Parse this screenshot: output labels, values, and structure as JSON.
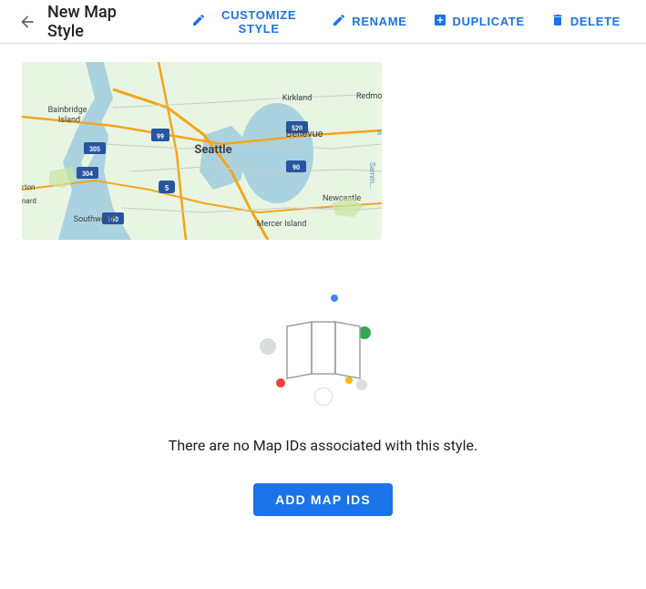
{
  "header": {
    "title": "New Map Style",
    "back_label": "back",
    "actions": [
      {
        "id": "customize",
        "label": "CUSTOMIZE STYLE",
        "icon": "pencil"
      },
      {
        "id": "rename",
        "label": "RENAME",
        "icon": "pencil"
      },
      {
        "id": "duplicate",
        "label": "DUPLICATE",
        "icon": "duplicate"
      },
      {
        "id": "delete",
        "label": "DELETE",
        "icon": "trash"
      }
    ]
  },
  "main": {
    "empty_state_text": "There are no Map IDs associated with this style.",
    "add_map_ids_label": "ADD MAP IDS"
  },
  "colors": {
    "blue": "#1a73e8",
    "red": "#ea4335",
    "green": "#34a853",
    "yellow": "#fbbc04",
    "dot_light_blue": "#4285f4",
    "dot_light_gray": "#bdc1c6"
  }
}
